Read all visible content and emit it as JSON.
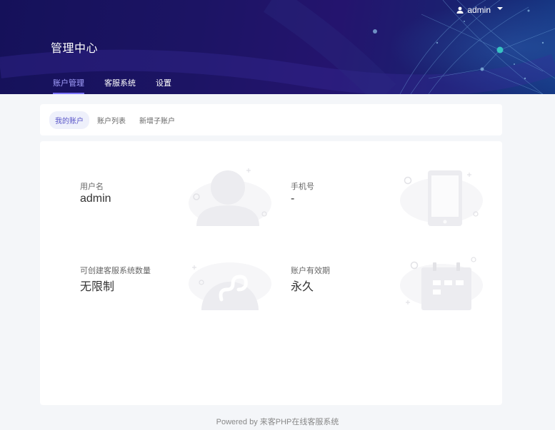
{
  "header": {
    "username": "admin",
    "title": "管理中心",
    "nav": [
      "账户管理",
      "客服系统",
      "设置"
    ]
  },
  "subnav": [
    "我的账户",
    "账户列表",
    "新增子账户"
  ],
  "account": {
    "username_label": "用户名",
    "username_value": "admin",
    "phone_label": "手机号",
    "phone_value": "-",
    "quota_label": "可创建客服系统数量",
    "quota_value": "无限制",
    "validity_label": "账户有效期",
    "validity_value": "永久"
  },
  "footer": "Powered by 来客PHP在线客服系统",
  "colors": {
    "header_bg": "#1c1464",
    "accent": "#7a73ff",
    "page_bg": "#f4f6f9",
    "icon_gray": "#ececf0"
  },
  "icons": {
    "user_menu": "user-icon",
    "username": "user-avatar-icon",
    "phone": "phone-icon",
    "quota": "mini-program-icon",
    "validity": "calendar-icon"
  }
}
